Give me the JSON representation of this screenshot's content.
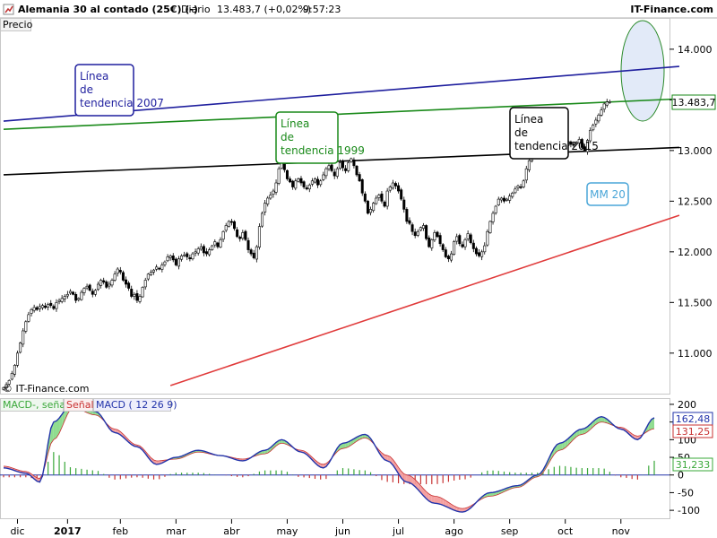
{
  "header": {
    "title": "Alemania 30 al contado (25€) (-)",
    "period": "Diario",
    "last": "13.483,7 (+0,02%)",
    "time": "9:57:23",
    "brand": "IT-Finance.com"
  },
  "price_panel_label": "Precio",
  "watermark": "© IT-Finance.com",
  "last_price_label": "13.483,7",
  "annotations": {
    "tl2007": "Línea de tendencia 2007",
    "tl1999": "Línea de tendencia 1999",
    "tl2015": "Línea de tendencia 2015",
    "mm20": "MM 20"
  },
  "macd_legend": {
    "macd_signal": "MACD-, señal",
    "signal": "Señal",
    "macd": "MACD ( 12 26 9)"
  },
  "macd_value_labels": {
    "macd": "162,48",
    "signal": "131,25",
    "hist": "31,233"
  },
  "colors": {
    "tl2007": "#1f1f9e",
    "tl1999": "#1a8a1a",
    "tl2015": "#000000",
    "support": "#e03a3a",
    "mm20": "#4aa6d8",
    "macd_line": "#2233aa",
    "macd_fill_pos": "#8fdc8f",
    "macd_fill_neg": "#f4a0a0",
    "hist_pos": "#3aa83a",
    "hist_neg": "#c83232",
    "ellipse": "#2a8a2a",
    "ellipse_fill": "#dde6f7"
  },
  "chart_data": [
    {
      "type": "line",
      "ylim": [
        10600,
        14300
      ],
      "ytick_labels": [
        "14.000",
        "13.500",
        "13.000",
        "12.500",
        "12.000",
        "11.500",
        "11.000"
      ],
      "yticks": [
        14000,
        13500,
        13000,
        12500,
        12000,
        11500,
        11000
      ],
      "xtick_labels": [
        "dic",
        "2017",
        "feb",
        "mar",
        "abr",
        "may",
        "jun",
        "jul",
        "ago",
        "sep",
        "oct",
        "nov"
      ],
      "xtick_idx": [
        5,
        23,
        42,
        62,
        82,
        102,
        122,
        142,
        162,
        182,
        202,
        222
      ],
      "n_days": 235,
      "closes": [
        10660,
        10690,
        10730,
        10800,
        10880,
        11000,
        11100,
        11220,
        11310,
        11380,
        11430,
        11450,
        11430,
        11460,
        11470,
        11450,
        11480,
        11470,
        11440,
        11500,
        11520,
        11540,
        11560,
        11580,
        11610,
        11580,
        11520,
        11540,
        11600,
        11640,
        11660,
        11620,
        11580,
        11620,
        11680,
        11720,
        11700,
        11650,
        11680,
        11720,
        11780,
        11830,
        11800,
        11720,
        11680,
        11640,
        11560,
        11580,
        11520,
        11560,
        11650,
        11720,
        11780,
        11800,
        11820,
        11850,
        11830,
        11870,
        11900,
        11950,
        11960,
        11920,
        11870,
        11930,
        11960,
        11970,
        11950,
        11930,
        11980,
        12000,
        12030,
        12050,
        11990,
        11980,
        12020,
        12060,
        12100,
        12050,
        12120,
        12200,
        12260,
        12300,
        12290,
        12230,
        12150,
        12130,
        12190,
        12120,
        12020,
        11980,
        11940,
        12050,
        12250,
        12380,
        12480,
        12530,
        12560,
        12600,
        12680,
        12820,
        12880,
        12810,
        12720,
        12690,
        12640,
        12700,
        12720,
        12680,
        12640,
        12620,
        12660,
        12700,
        12720,
        12660,
        12700,
        12760,
        12820,
        12850,
        12800,
        12750,
        12820,
        12880,
        12830,
        12800,
        12880,
        12920,
        12850,
        12760,
        12700,
        12580,
        12500,
        12380,
        12420,
        12480,
        12530,
        12560,
        12500,
        12450,
        12600,
        12640,
        12680,
        12650,
        12600,
        12520,
        12420,
        12300,
        12280,
        12200,
        12160,
        12200,
        12240,
        12260,
        12130,
        12050,
        12120,
        12190,
        12150,
        12080,
        12020,
        11950,
        11930,
        11980,
        12100,
        12150,
        12080,
        12050,
        12120,
        12180,
        12090,
        12030,
        11980,
        11960,
        12000,
        12060,
        12200,
        12300,
        12380,
        12450,
        12520,
        12530,
        12500,
        12520,
        12550,
        12580,
        12620,
        12650,
        12640,
        12700,
        12820,
        12900,
        12950,
        13000,
        13020,
        12990,
        12970,
        13010,
        13030,
        12980,
        13050,
        13060,
        13000,
        12980,
        13060,
        13090,
        13060,
        13050,
        13080,
        13110,
        13030,
        13000,
        13100,
        13200,
        13250,
        13300,
        13350,
        13400,
        13460,
        13480,
        13483
      ]
    },
    {
      "type": "line",
      "title": "MACD ( 12 26 9)",
      "ylim": [
        -120,
        210
      ],
      "ytick_labels": [
        "200",
        "150",
        "100",
        "50",
        "0",
        "-50",
        "-100"
      ],
      "yticks": [
        200,
        150,
        100,
        50,
        0,
        -50,
        -100
      ],
      "series": [
        {
          "name": "MACD",
          "keys": [
            [
              0,
              20
            ],
            [
              8,
              5
            ],
            [
              13,
              -20
            ],
            [
              18,
              150
            ],
            [
              25,
              205
            ],
            [
              33,
              180
            ],
            [
              40,
              120
            ],
            [
              48,
              80
            ],
            [
              55,
              30
            ],
            [
              62,
              50
            ],
            [
              70,
              70
            ],
            [
              78,
              55
            ],
            [
              86,
              40
            ],
            [
              94,
              70
            ],
            [
              100,
              100
            ],
            [
              107,
              65
            ],
            [
              115,
              20
            ],
            [
              122,
              90
            ],
            [
              130,
              115
            ],
            [
              138,
              40
            ],
            [
              145,
              -20
            ],
            [
              155,
              -80
            ],
            [
              165,
              -105
            ],
            [
              175,
              -50
            ],
            [
              185,
              -30
            ],
            [
              192,
              0
            ],
            [
              200,
              90
            ],
            [
              208,
              130
            ],
            [
              215,
              165
            ],
            [
              222,
              130
            ],
            [
              228,
              100
            ],
            [
              234,
              162
            ]
          ]
        },
        {
          "name": "Señal",
          "keys": [
            [
              0,
              25
            ],
            [
              8,
              10
            ],
            [
              13,
              -10
            ],
            [
              18,
              100
            ],
            [
              25,
              190
            ],
            [
              33,
              170
            ],
            [
              40,
              130
            ],
            [
              48,
              85
            ],
            [
              55,
              40
            ],
            [
              62,
              45
            ],
            [
              70,
              65
            ],
            [
              78,
              55
            ],
            [
              86,
              45
            ],
            [
              94,
              60
            ],
            [
              100,
              90
            ],
            [
              107,
              70
            ],
            [
              115,
              30
            ],
            [
              122,
              75
            ],
            [
              130,
              105
            ],
            [
              138,
              55
            ],
            [
              145,
              0
            ],
            [
              155,
              -60
            ],
            [
              165,
              -95
            ],
            [
              175,
              -60
            ],
            [
              185,
              -35
            ],
            [
              192,
              -5
            ],
            [
              200,
              70
            ],
            [
              208,
              115
            ],
            [
              215,
              150
            ],
            [
              222,
              135
            ],
            [
              228,
              110
            ],
            [
              234,
              131
            ]
          ]
        }
      ]
    }
  ]
}
